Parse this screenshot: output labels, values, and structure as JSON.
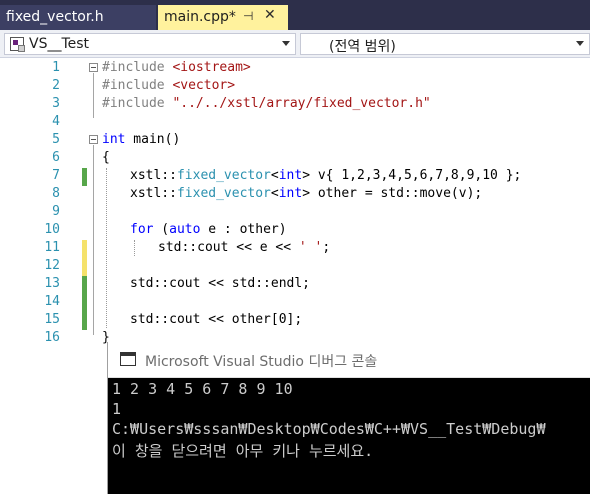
{
  "tabs": [
    {
      "label": "fixed_vector.h",
      "active": false
    },
    {
      "label": "main.cpp*",
      "active": true,
      "pin_glyph": "⊣",
      "close_glyph": "✕"
    }
  ],
  "navbar": {
    "project_scope": "VS__Test",
    "member_scope": "(전역 범위)"
  },
  "editor": {
    "line_numbers": [
      "1",
      "2",
      "3",
      "4",
      "5",
      "6",
      "7",
      "8",
      "9",
      "10",
      "11",
      "12",
      "13",
      "14",
      "15",
      "16"
    ],
    "lines": {
      "l1_kw": "#include",
      "l1_str": "<iostream>",
      "l2_kw": "#include",
      "l2_str": "<vector>",
      "l3_kw": "#include",
      "l3_str": "\"../../xstl/array/fixed_vector.h\"",
      "l5_kw": "int",
      "l5_rest": " main()",
      "l6": "{",
      "l7_a": "xstl::",
      "l7_type": "fixed_vector",
      "l7_b": "<",
      "l7_kw": "int",
      "l7_c": "> v{ 1,2,3,4,5,6,7,8,9,10 };",
      "l8_a": "xstl::",
      "l8_type": "fixed_vector",
      "l8_b": "<",
      "l8_kw": "int",
      "l8_c": "> other = std::move(v);",
      "l10_kw1": "for",
      "l10_a": " (",
      "l10_kw2": "auto",
      "l10_b": " e : other)",
      "l11_a": "std::cout << e << ",
      "l11_str": "' '",
      "l11_b": ";",
      "l13": "std::cout << std::endl;",
      "l15": "std::cout << other[0];",
      "l16": "}"
    }
  },
  "console": {
    "title": "Microsoft Visual Studio 디버그 콘솔",
    "output": [
      "1 2 3 4 5 6 7 8 9 10",
      "1",
      "C:₩Users₩sssan₩Desktop₩Codes₩C++₩VS__Test₩Debug₩",
      "이 창을 닫으려면 아무 키나 누르세요."
    ]
  },
  "colors": {
    "tabstrip_bg": "#2d2f4a",
    "active_tab_bg": "#fff29d",
    "line_number": "#2b91af",
    "keyword": "#0000ff",
    "string": "#a31515",
    "type": "#2b91af",
    "changed_saved": "#57a64a",
    "changed_unsaved": "#f5e26b",
    "console_bg": "#000000",
    "console_text": "#cccccc"
  }
}
